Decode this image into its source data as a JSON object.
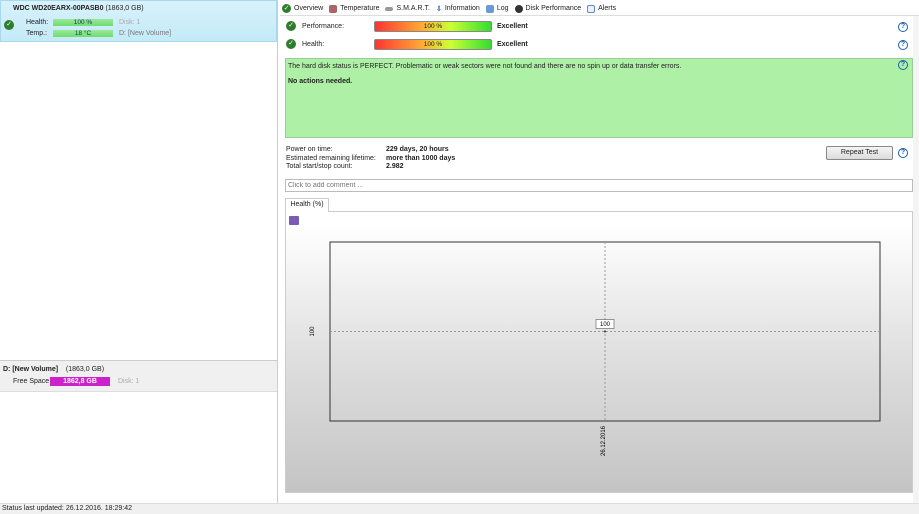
{
  "disk": {
    "name": "WDC WD20EARX-00PASB0",
    "size": "(1863,0 GB)",
    "health_label": "Health:",
    "health_value": "100 %",
    "health_pct": 100,
    "temp_label": "Temp.:",
    "temp_value": "18 °C",
    "disk_ref": "Disk: 1",
    "volume_ref": "D: [New Volume]"
  },
  "volume": {
    "name": "D: [New Volume]",
    "size": "(1863,0 GB)",
    "free_label": "Free Space",
    "free_value": "1862,8 GB",
    "disk_ref": "Disk: 1"
  },
  "status": "Status last updated: 26.12.2016. 18:29:42",
  "tabs": [
    "Overview",
    "Temperature",
    "S.M.A.R.T.",
    "Information",
    "Log",
    "Disk Performance",
    "Alerts"
  ],
  "overview": {
    "performance_label": "Performance:",
    "performance_value": "100 %",
    "performance_pct": 100,
    "performance_rating": "Excellent",
    "health_label": "Health:",
    "health_value": "100 %",
    "health_pct": 100,
    "health_rating": "Excellent",
    "message": "The hard disk status is PERFECT. Problematic or weak sectors were not found and there are no spin up or data transfer errors.",
    "action": "No actions needed.",
    "info": [
      {
        "label": "Power on time:",
        "value": "229 days, 20 hours"
      },
      {
        "label": "Estimated remaining lifetime:",
        "value": "more than 1000 days"
      },
      {
        "label": "Total start/stop count:",
        "value": "2.982"
      }
    ],
    "repeat_test": "Repeat Test",
    "comment_placeholder": "Click to add comment ...",
    "chart_tab": "Health (%)"
  },
  "chart_data": {
    "type": "line",
    "title": "Health (%)",
    "x": [
      "26.12.2016"
    ],
    "values": [
      100
    ],
    "point_label": "100",
    "ytick": "100",
    "xtick": "26.12.2016"
  },
  "colors": {
    "accent_green": "#aef0a6",
    "free_space": "#cc22cc"
  }
}
